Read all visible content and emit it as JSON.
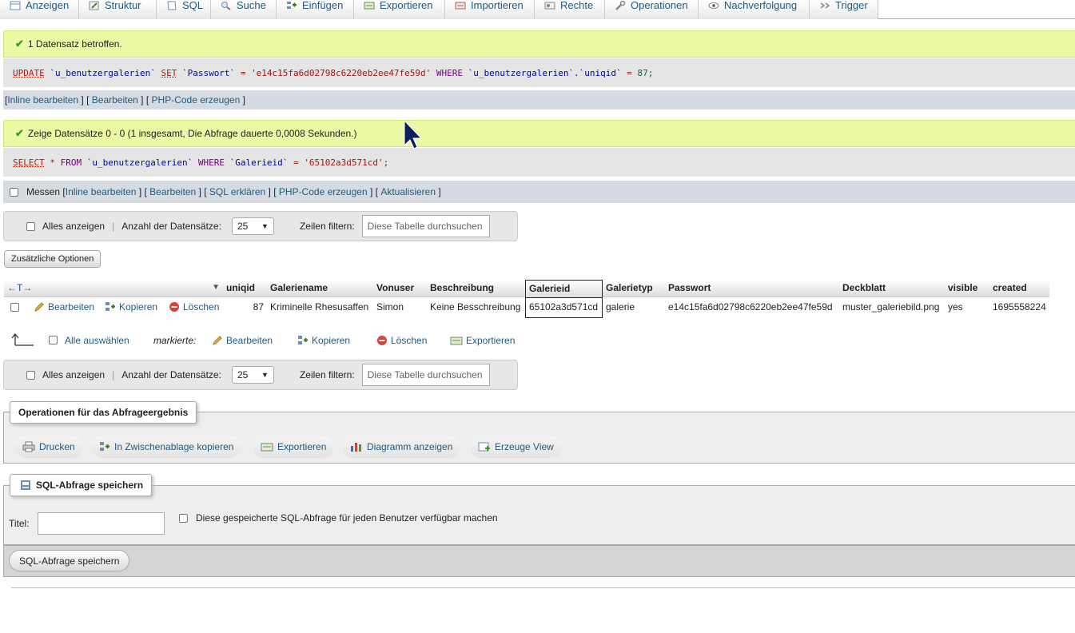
{
  "tabs": [
    {
      "label": "Anzeigen",
      "icon": "table-browse-icon"
    },
    {
      "label": "Struktur",
      "icon": "structure-icon"
    },
    {
      "label": "SQL",
      "icon": "sql-icon"
    },
    {
      "label": "Suche",
      "icon": "search-icon"
    },
    {
      "label": "Einfügen",
      "icon": "insert-icon"
    },
    {
      "label": "Exportieren",
      "icon": "export-icon"
    },
    {
      "label": "Importieren",
      "icon": "import-icon"
    },
    {
      "label": "Rechte",
      "icon": "privileges-icon"
    },
    {
      "label": "Operationen",
      "icon": "wrench-icon"
    },
    {
      "label": "Nachverfolgung",
      "icon": "eye-icon"
    },
    {
      "label": "Trigger",
      "icon": "trigger-icon"
    }
  ],
  "msg1": {
    "status": "1 Datensatz betroffen.",
    "sql": {
      "kw_update": "UPDATE",
      "table": "`u_benutzergalerien`",
      "kw_set": "SET",
      "col": "`Passwort`",
      "eq": "=",
      "value": "'e14c15fa6d02798c6220eb2ee47fe59d'",
      "kw_where": "WHERE",
      "qualified": "`u_benutzergalerien`.`uniqid`",
      "eq2": "=",
      "num": "87",
      "end": ";"
    },
    "links": {
      "inline": "Inline bearbeiten",
      "edit": "Bearbeiten",
      "php": "PHP-Code erzeugen",
      "open": "[",
      "close": "]",
      "sep": "] ["
    }
  },
  "msg2": {
    "status": "Zeige Datensätze 0 - 0 (1 insgesamt, Die Abfrage dauerte 0,0008 Sekunden.)",
    "sql": {
      "kw_select": "SELECT",
      "star": "*",
      "kw_from": "FROM",
      "table": "`u_benutzergalerien`",
      "kw_where": "WHERE",
      "col": "`Galerieid`",
      "eq": "=",
      "value": "'65102a3d571cd'",
      "end": ";"
    },
    "links": {
      "measure": "Messen",
      "inline": "Inline bearbeiten",
      "edit": "Bearbeiten",
      "explain": "SQL erklären",
      "php": "PHP-Code erzeugen",
      "refresh": "Aktualisieren",
      "open": "[",
      "close": "]",
      "sep": "] ["
    }
  },
  "nav": {
    "show_all": "Alles anzeigen",
    "rows_label": "Anzahl der Datensätze:",
    "rows_value": "25",
    "filter_label": "Zeilen filtern:",
    "filter_placeholder": "Diese Tabelle durchsuchen",
    "pipe": "|"
  },
  "extra_options": "Zusätzliche Optionen",
  "table": {
    "arrows": "←T→",
    "columns": [
      "uniqid",
      "Galeriename",
      "Vonuser",
      "Beschreibung",
      "Galerieid",
      "Galerietyp",
      "Passwort",
      "Deckblatt",
      "visible",
      "created"
    ],
    "row": {
      "edit": "Bearbeiten",
      "copy": "Kopieren",
      "delete": "Löschen",
      "cells": [
        "87",
        "Kriminelle Rhesusaffen",
        "Simon",
        "Keine Besschreibung",
        "65102a3d571cd",
        "galerie",
        "e14c15fa6d02798c6220eb2ee47fe59d",
        "muster_galeriebild.png",
        "yes",
        "1695558224"
      ]
    }
  },
  "bulk": {
    "select_all": "Alle auswählen",
    "marked": "markierte:",
    "edit": "Bearbeiten",
    "copy": "Kopieren",
    "delete": "Löschen",
    "export": "Exportieren"
  },
  "operations": {
    "legend": "Operationen für das Abfrageergebnis",
    "print": "Drucken",
    "clipboard": "In Zwischenablage kopieren",
    "export": "Exportieren",
    "chart": "Diagramm anzeigen",
    "view": "Erzeuge View"
  },
  "bookmark": {
    "legend": "SQL-Abfrage speichern",
    "title_label": "Titel:",
    "share_label": "Diese gespeicherte SQL-Abfrage für jeden Benutzer verfügbar machen",
    "submit": "SQL-Abfrage speichern"
  },
  "colors": {
    "link": "#235a81",
    "success_bg": "#ebf8a4",
    "sql_bg": "#e5e5e5",
    "linkbar_bg": "#d5dbe0"
  }
}
